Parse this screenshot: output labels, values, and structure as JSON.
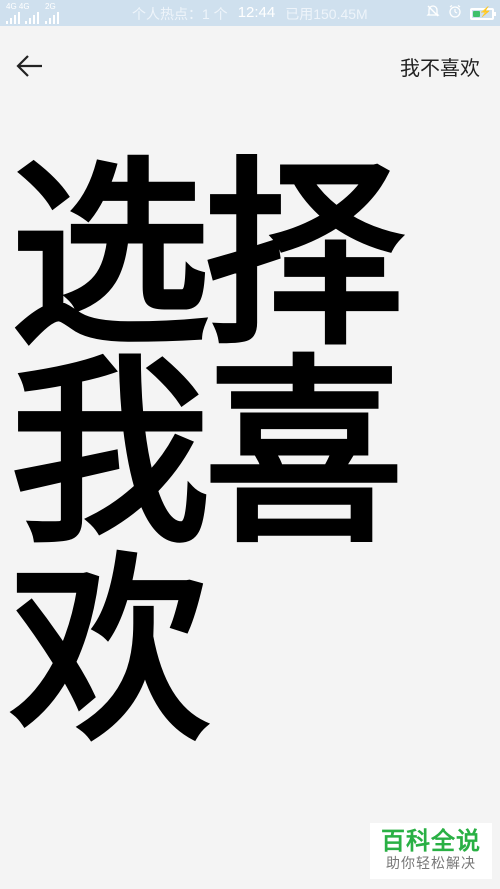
{
  "status_bar": {
    "network_primary": "4G 4G",
    "network_secondary": "2G",
    "hotspot": "个人热点：1 个",
    "time": "12:44",
    "data_used": "已用150.45M",
    "battery_level": 0.4,
    "colors": {
      "background": "#cfe0ee",
      "battery_fill": "#3ec06a"
    },
    "icons": [
      "signal-icon",
      "mute-bell-icon",
      "alarm-icon",
      "battery-icon"
    ]
  },
  "top_bar": {
    "back_icon": "arrow-left-icon",
    "dislike_label": "我不喜欢"
  },
  "content": {
    "big_lines": [
      "选择",
      "我喜",
      "欢"
    ]
  },
  "watermark": {
    "title": "百科全说",
    "subtitle": "助你轻松解决",
    "color": "#29b044"
  }
}
